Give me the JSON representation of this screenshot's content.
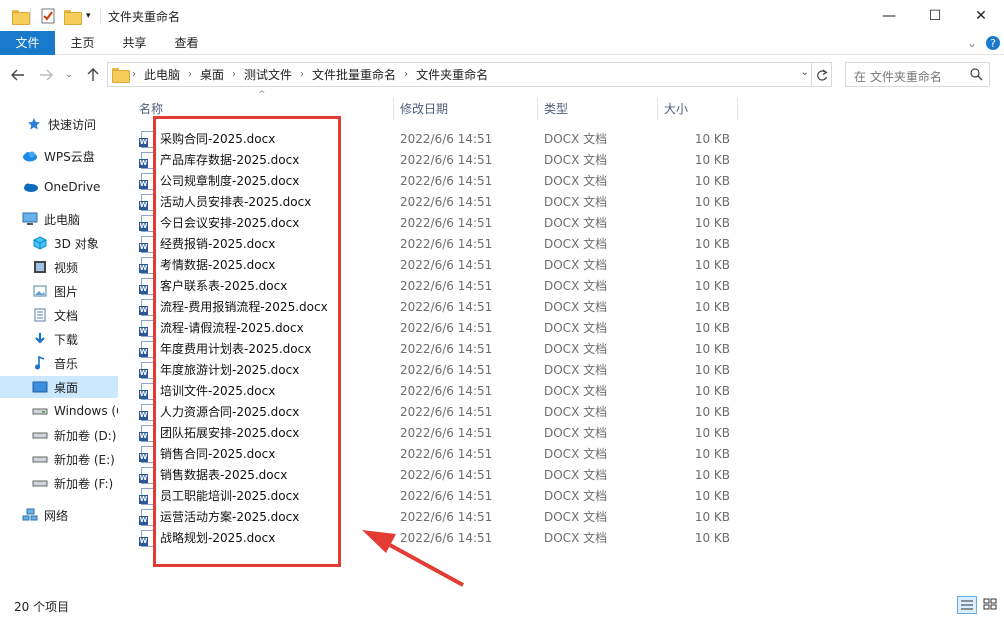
{
  "window": {
    "title": "文件夹重命名",
    "minimize": "—",
    "maximize": "☐",
    "close": "✕"
  },
  "ribbon": {
    "tabs": [
      "文件",
      "主页",
      "共享",
      "查看"
    ],
    "expand": "⌄",
    "help": "?"
  },
  "address": {
    "crumbs": [
      "此电脑",
      "桌面",
      "测试文件",
      "文件批量重命名",
      "文件夹重命名"
    ],
    "search_placeholder": "在 文件夹重命名"
  },
  "nav": {
    "items": [
      {
        "label": "快速访问",
        "icon": "star-icon"
      },
      {
        "label": "WPS云盘",
        "icon": "cloud-icon"
      },
      {
        "label": "OneDrive",
        "icon": "onedrive-icon"
      },
      {
        "label": "此电脑",
        "icon": "computer-icon"
      },
      {
        "label": "3D 对象",
        "icon": "cube-icon"
      },
      {
        "label": "视频",
        "icon": "video-icon"
      },
      {
        "label": "图片",
        "icon": "image-icon"
      },
      {
        "label": "文档",
        "icon": "document-icon"
      },
      {
        "label": "下载",
        "icon": "download-icon"
      },
      {
        "label": "音乐",
        "icon": "music-icon"
      },
      {
        "label": "桌面",
        "icon": "desktop-icon"
      },
      {
        "label": "Windows (C",
        "icon": "drive-icon"
      },
      {
        "label": "新加卷 (D:)",
        "icon": "drive-icon"
      },
      {
        "label": "新加卷 (E:)",
        "icon": "drive-icon"
      },
      {
        "label": "新加卷 (F:)",
        "icon": "drive-icon"
      },
      {
        "label": "网络",
        "icon": "network-icon"
      }
    ],
    "selected": "桌面"
  },
  "columns": {
    "name": "名称",
    "date": "修改日期",
    "type": "类型",
    "size": "大小"
  },
  "files": [
    {
      "name": "采购合同-2025.docx",
      "date": "2022/6/6 14:51",
      "type": "DOCX 文档",
      "size": "10 KB"
    },
    {
      "name": "产品库存数据-2025.docx",
      "date": "2022/6/6 14:51",
      "type": "DOCX 文档",
      "size": "10 KB"
    },
    {
      "name": "公司规章制度-2025.docx",
      "date": "2022/6/6 14:51",
      "type": "DOCX 文档",
      "size": "10 KB"
    },
    {
      "name": "活动人员安排表-2025.docx",
      "date": "2022/6/6 14:51",
      "type": "DOCX 文档",
      "size": "10 KB"
    },
    {
      "name": "今日会议安排-2025.docx",
      "date": "2022/6/6 14:51",
      "type": "DOCX 文档",
      "size": "10 KB"
    },
    {
      "name": "经费报销-2025.docx",
      "date": "2022/6/6 14:51",
      "type": "DOCX 文档",
      "size": "10 KB"
    },
    {
      "name": "考情数据-2025.docx",
      "date": "2022/6/6 14:51",
      "type": "DOCX 文档",
      "size": "10 KB"
    },
    {
      "name": "客户联系表-2025.docx",
      "date": "2022/6/6 14:51",
      "type": "DOCX 文档",
      "size": "10 KB"
    },
    {
      "name": "流程-费用报销流程-2025.docx",
      "date": "2022/6/6 14:51",
      "type": "DOCX 文档",
      "size": "10 KB"
    },
    {
      "name": "流程-请假流程-2025.docx",
      "date": "2022/6/6 14:51",
      "type": "DOCX 文档",
      "size": "10 KB"
    },
    {
      "name": "年度费用计划表-2025.docx",
      "date": "2022/6/6 14:51",
      "type": "DOCX 文档",
      "size": "10 KB"
    },
    {
      "name": "年度旅游计划-2025.docx",
      "date": "2022/6/6 14:51",
      "type": "DOCX 文档",
      "size": "10 KB"
    },
    {
      "name": "培训文件-2025.docx",
      "date": "2022/6/6 14:51",
      "type": "DOCX 文档",
      "size": "10 KB"
    },
    {
      "name": "人力资源合同-2025.docx",
      "date": "2022/6/6 14:51",
      "type": "DOCX 文档",
      "size": "10 KB"
    },
    {
      "name": "团队拓展安排-2025.docx",
      "date": "2022/6/6 14:51",
      "type": "DOCX 文档",
      "size": "10 KB"
    },
    {
      "name": "销售合同-2025.docx",
      "date": "2022/6/6 14:51",
      "type": "DOCX 文档",
      "size": "10 KB"
    },
    {
      "name": "销售数据表-2025.docx",
      "date": "2022/6/6 14:51",
      "type": "DOCX 文档",
      "size": "10 KB"
    },
    {
      "name": "员工职能培训-2025.docx",
      "date": "2022/6/6 14:51",
      "type": "DOCX 文档",
      "size": "10 KB"
    },
    {
      "name": "运营活动方案-2025.docx",
      "date": "2022/6/6 14:51",
      "type": "DOCX 文档",
      "size": "10 KB"
    },
    {
      "name": "战略规划-2025.docx",
      "date": "2022/6/6 14:51",
      "type": "DOCX 文档",
      "size": "10 KB"
    }
  ],
  "status": {
    "count": "20 个项目"
  },
  "colors": {
    "accent": "#1979ca",
    "selected": "#cce8ff",
    "annotation": "#e53b35"
  }
}
